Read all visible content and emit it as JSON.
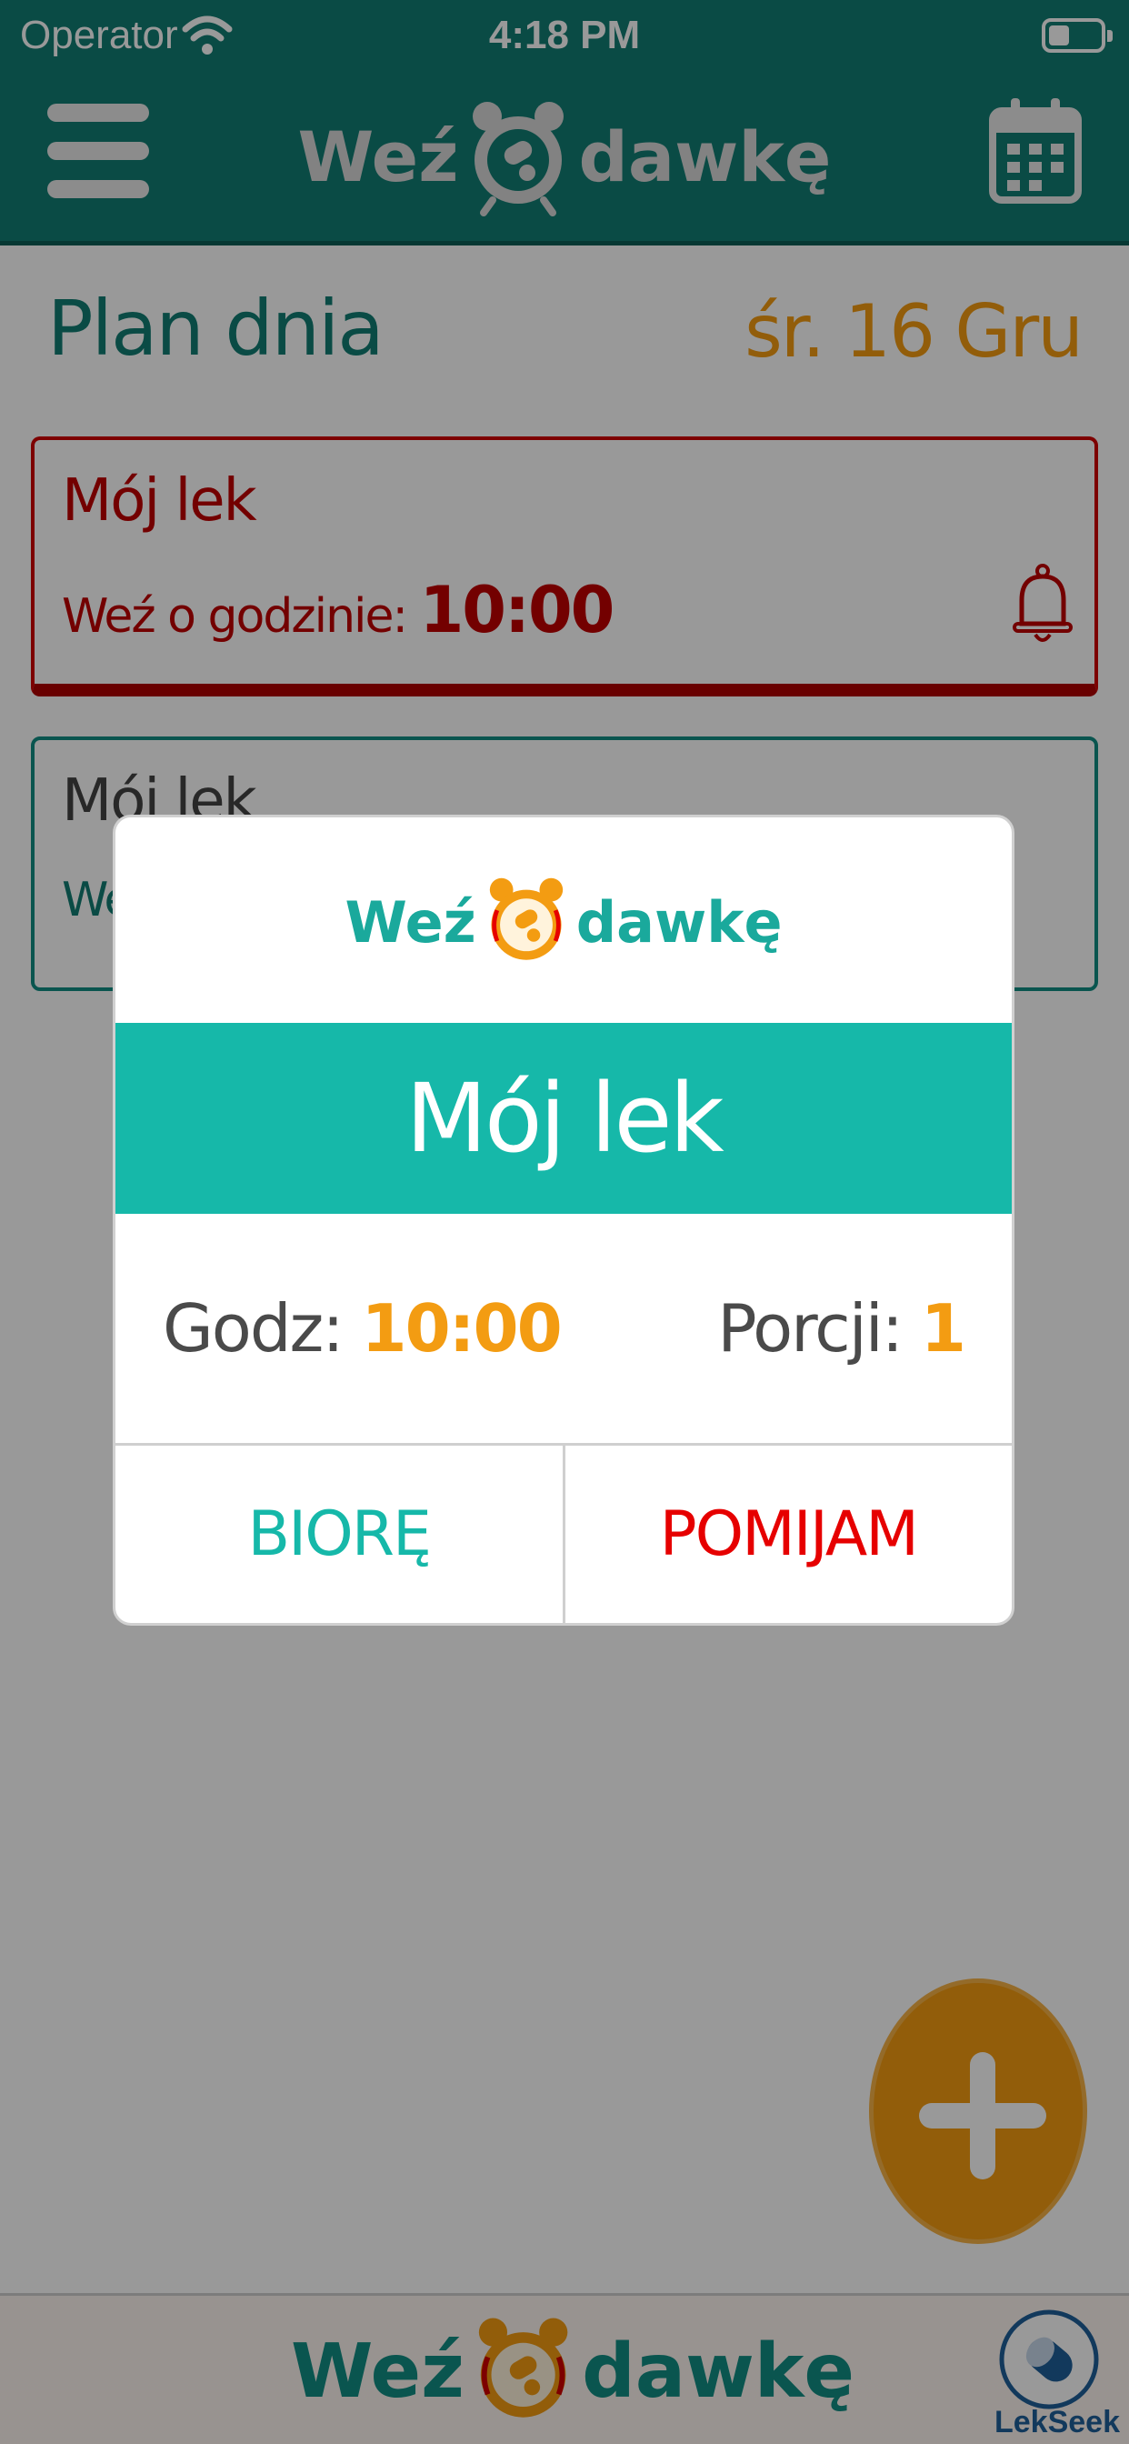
{
  "status": {
    "operator": "Operator",
    "time": "4:18 PM"
  },
  "nav": {
    "logo_word1": "Weź",
    "logo_word2": "dawkę",
    "menu_icon": "hamburger-menu-icon",
    "calendar_icon": "calendar-icon"
  },
  "plan": {
    "title": "Plan dnia",
    "date": "śr. 16 Gru"
  },
  "cards": [
    {
      "name": "Mój lek",
      "time_label": "Weź o godzinie:",
      "time": "10:00",
      "state": "due"
    },
    {
      "name": "Mój lek",
      "time_label": "We",
      "time": "",
      "state": "upcoming"
    }
  ],
  "dialog": {
    "logo_word1": "Weź",
    "logo_word2": "dawkę",
    "title": "Mój lek",
    "time_label": "Godz:",
    "time_value": "10:00",
    "portion_label": "Porcji:",
    "portion_value": "1",
    "take_label": "BIORĘ",
    "skip_label": "POMIJAM"
  },
  "footer": {
    "logo_word1": "Weź",
    "logo_word2": "dawkę",
    "brand": "LekSeek"
  },
  "colors": {
    "primary": "#127e73",
    "accent": "#16b8a9",
    "orange": "#f39c12",
    "alert": "#c00000",
    "skip": "#e60000"
  }
}
